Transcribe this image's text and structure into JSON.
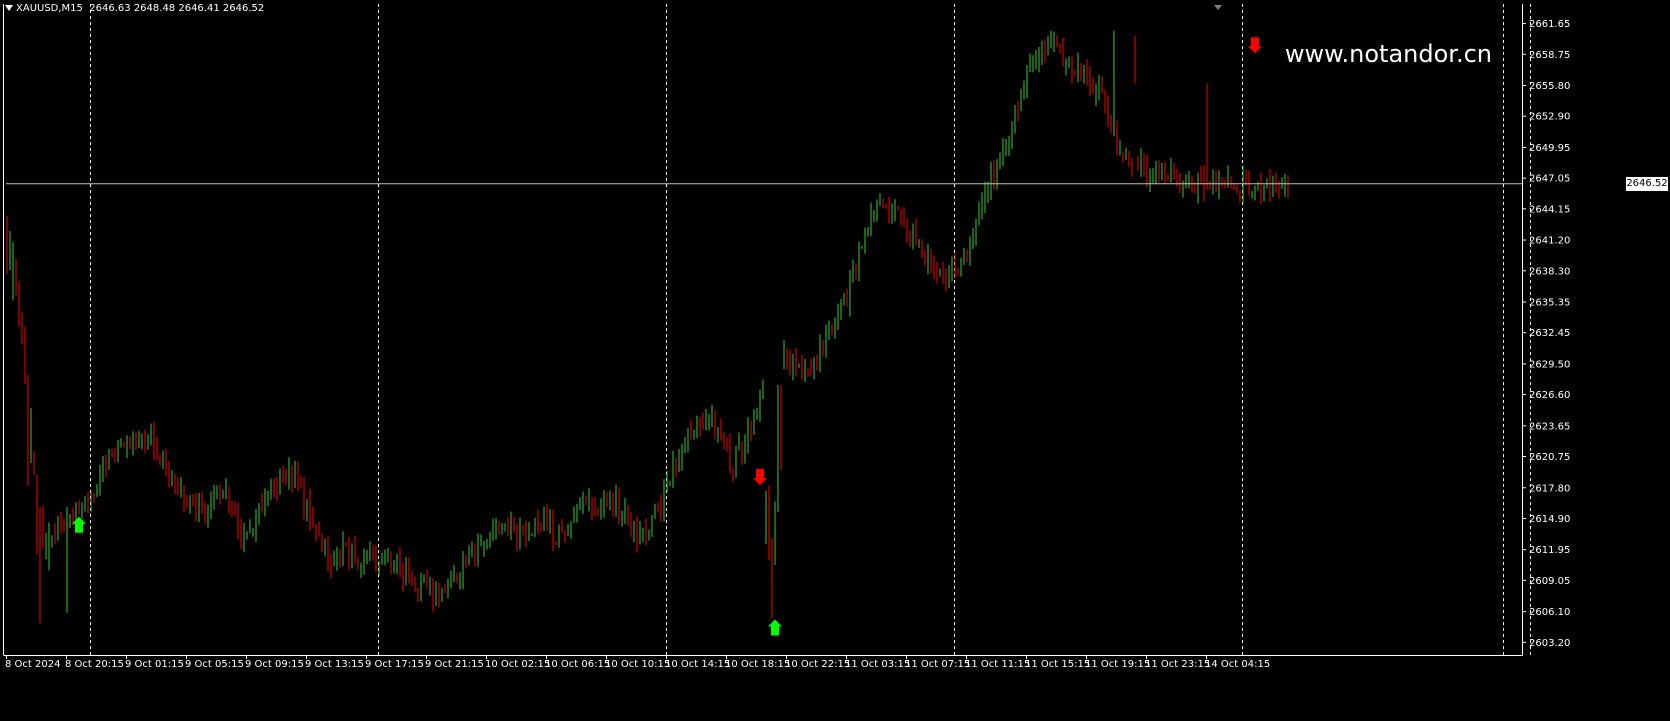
{
  "header": {
    "symbol": "XAUUSD,M15",
    "ohlc": "2646.63 2648.48 2646.41 2646.52"
  },
  "watermark": "www.notandor.cn",
  "colors": {
    "background": "#000000",
    "bull": "#32cd32",
    "bear": "#ff0000",
    "axis_text": "#ffffff",
    "grid": "#ffffff",
    "bid_line": "#c0c0c0",
    "buy_arrow": "#00ff00",
    "sell_arrow": "#ff0000"
  },
  "chart_data": {
    "type": "candlestick",
    "symbol": "XAUUSD",
    "timeframe": "M15",
    "current_price": 2646.52,
    "ylim": [
      2602.0,
      2663.5
    ],
    "y_ticks": [
      2661.65,
      2658.75,
      2655.8,
      2652.9,
      2649.95,
      2647.05,
      2644.15,
      2641.2,
      2638.3,
      2635.35,
      2632.45,
      2629.5,
      2626.6,
      2623.65,
      2620.75,
      2617.8,
      2614.9,
      2611.95,
      2609.05,
      2606.1,
      2603.2
    ],
    "y_tick_labels": [
      "2661.65",
      "2658.75",
      "2655.80",
      "2652.90",
      "2649.95",
      "2647.05",
      "2644.15",
      "2641.20",
      "2638.30",
      "2635.35",
      "2632.45",
      "2629.50",
      "2626.60",
      "2623.65",
      "2620.75",
      "2617.80",
      "2614.90",
      "2611.95",
      "2609.05",
      "2606.10",
      "2603.20"
    ],
    "x_labels": [
      "8 Oct 2024",
      "8 Oct 20:15",
      "9 Oct 01:15",
      "9 Oct 05:15",
      "9 Oct 09:15",
      "9 Oct 13:15",
      "9 Oct 17:15",
      "9 Oct 21:15",
      "10 Oct 02:15",
      "10 Oct 06:15",
      "10 Oct 10:15",
      "10 Oct 14:15",
      "10 Oct 18:15",
      "10 Oct 22:15",
      "11 Oct 03:15",
      "11 Oct 07:15",
      "11 Oct 11:15",
      "11 Oct 15:15",
      "11 Oct 19:15",
      "11 Oct 23:15",
      "14 Oct 04:15"
    ],
    "bars_per_label": 20,
    "day_separators_after_bars": [
      28,
      124,
      220,
      316,
      412,
      508
    ],
    "path": {
      "bar_index": [
        0,
        2,
        4,
        8,
        12,
        18,
        24,
        30,
        34,
        42,
        48,
        55,
        60,
        66,
        72,
        78,
        86,
        94,
        102,
        108,
        112,
        118,
        126,
        134,
        142,
        150,
        158,
        166,
        172,
        178,
        184,
        188,
        194,
        202,
        210,
        218,
        226,
        234,
        242,
        250,
        258,
        262,
        268,
        276,
        280,
        286,
        292,
        302,
        312,
        320,
        328,
        334,
        340,
        344,
        348,
        352,
        358,
        364,
        370,
        376,
        384,
        392,
        400,
        404,
        410,
        416,
        421,
        427
      ],
      "close": [
        2640.5,
        2639.5,
        2634.0,
        2622.0,
        2612.0,
        2614.5,
        2615.0,
        2618.5,
        2621.5,
        2621.5,
        2622.5,
        2619.0,
        2616.5,
        2615.5,
        2617.5,
        2613.0,
        2616.5,
        2619.5,
        2615.0,
        2610.0,
        2612.0,
        2611.0,
        2611.5,
        2609.0,
        2608.0,
        2609.5,
        2613.0,
        2614.0,
        2613.5,
        2614.5,
        2613.0,
        2615.0,
        2616.0,
        2617.0,
        2613.0,
        2616.0,
        2622.5,
        2624.5,
        2620.0,
        2625.0,
        2630.0,
        2629.5,
        2629.0,
        2633.5,
        2636.0,
        2642.0,
        2645.5,
        2641.5,
        2637.0,
        2640.0,
        2647.0,
        2651.0,
        2656.5,
        2659.5,
        2660.0,
        2658.0,
        2657.0,
        2655.5,
        2649.5,
        2648.0,
        2647.5,
        2646.52,
        2646.52,
        2646.52,
        2646.52,
        2646.52,
        2646.52,
        2646.52
      ]
    },
    "anchors": [
      {
        "bar": 0,
        "open": 2643.0,
        "high": 2643.5,
        "low": 2638.0,
        "close": 2640.5
      },
      {
        "bar": 2,
        "open": 2638.5,
        "high": 2641.0,
        "low": 2635.5,
        "close": 2639.5
      },
      {
        "bar": 7,
        "open": 2628.0,
        "high": 2628.5,
        "low": 2618.0,
        "close": 2621.0
      },
      {
        "bar": 10,
        "open": 2618.5,
        "high": 2619.0,
        "low": 2611.5,
        "close": 2614.0
      },
      {
        "bar": 11,
        "open": 2614.0,
        "high": 2616.0,
        "low": 2605.0,
        "close": 2612.5
      },
      {
        "bar": 14,
        "open": 2612.5,
        "high": 2614.5,
        "low": 2610.0,
        "close": 2613.0
      },
      {
        "bar": 20,
        "open": 2613.5,
        "high": 2616.0,
        "low": 2606.0,
        "close": 2614.5
      },
      {
        "bar": 253,
        "open": 2614.5,
        "high": 2617.5,
        "low": 2612.5,
        "close": 2616.0
      },
      {
        "bar": 254,
        "open": 2616.0,
        "high": 2618.0,
        "low": 2611.0,
        "close": 2613.0
      },
      {
        "bar": 255,
        "open": 2612.5,
        "high": 2613.0,
        "low": 2605.5,
        "close": 2611.5
      },
      {
        "bar": 256,
        "open": 2611.5,
        "high": 2616.5,
        "low": 2610.5,
        "close": 2616.0
      },
      {
        "bar": 257,
        "open": 2616.0,
        "high": 2627.5,
        "low": 2615.5,
        "close": 2625.5
      },
      {
        "bar": 258,
        "open": 2625.5,
        "high": 2627.5,
        "low": 2619.5,
        "close": 2621.0
      },
      {
        "bar": 369,
        "open": 2653.0,
        "high": 2661.0,
        "low": 2651.0,
        "close": 2657.0
      },
      {
        "bar": 376,
        "open": 2658.5,
        "high": 2660.5,
        "low": 2656.0,
        "close": 2657.0
      },
      {
        "bar": 400,
        "open": 2655.5,
        "high": 2656.0,
        "low": 2646.0,
        "close": 2649.5
      }
    ],
    "signals": [
      {
        "type": "buy",
        "bar": 24,
        "price": 2614.3
      },
      {
        "type": "sell",
        "bar": 251,
        "price": 2618.8
      },
      {
        "type": "buy",
        "bar": 256,
        "price": 2604.6
      },
      {
        "type": "sell",
        "bar": 416,
        "price": 2659.6
      }
    ],
    "grid": true,
    "vertical_grid_style": "dashed"
  }
}
